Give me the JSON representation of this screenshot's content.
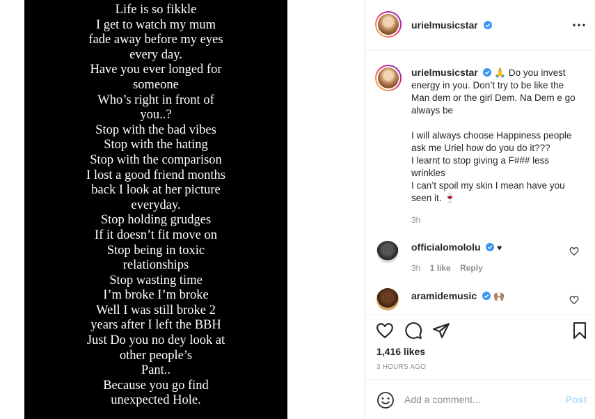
{
  "story": {
    "lines": [
      "Life is so fikkle",
      "I get to watch my mum",
      "fade away before my eyes",
      "every day.",
      "Have you ever longed for",
      "someone",
      "Who’s right in front of",
      "you..?",
      "Stop with the bad vibes",
      "Stop with the hating",
      "Stop with the comparison",
      "I lost a good friend months",
      "back I look at her picture",
      "everyday.",
      "Stop holding grudges",
      "If it doesn’t fit move on",
      "Stop being in toxic",
      "relationships",
      "Stop wasting time",
      "I’m broke I’m broke",
      "Well I was still broke 2",
      "years after I left the BBH",
      "Just Do you no dey look at",
      "other people’s",
      "Pant..",
      "Because you go find",
      "unexpected Hole."
    ]
  },
  "header": {
    "username": "urielmusicstar"
  },
  "caption": {
    "username": "urielmusicstar",
    "emoji": "🙏",
    "para1": "Do you invest energy in you. Don’t try to be like the Man dem or the girl Dem. Na Dem e go always be",
    "para2_lines": [
      "I will always choose Happiness people ask me Uriel how do you do it???",
      "I learnt to stop giving a F### less wrinkles",
      "I can’t spoil my skin I mean have you seen it. 🍷"
    ],
    "time": "3h"
  },
  "comments": [
    {
      "username": "officialomololu",
      "text": "♥",
      "time": "3h",
      "likes": "1 like",
      "reply": "Reply"
    },
    {
      "username": "aramidemusic",
      "text": "🙌🏽"
    }
  ],
  "likes_count": "1,416 likes",
  "posted_ago": "3 HOURS AGO",
  "add_comment_placeholder": "Add a comment...",
  "post_label": "Post",
  "colors": {
    "verified": "#3897f0",
    "post_button": "#b2dffc",
    "muted": "#8e8e8e"
  }
}
